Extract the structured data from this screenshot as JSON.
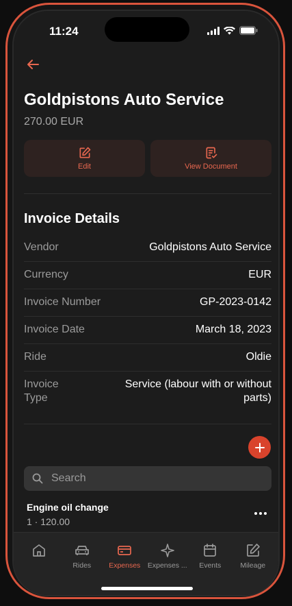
{
  "status": {
    "time": "11:24"
  },
  "header": {
    "title": "Goldpistons Auto Service",
    "amount": "270.00 EUR"
  },
  "actions": {
    "edit_label": "Edit",
    "view_document_label": "View Document"
  },
  "invoice": {
    "section_title": "Invoice Details",
    "rows": [
      {
        "label": "Vendor",
        "value": "Goldpistons Auto Service"
      },
      {
        "label": "Currency",
        "value": "EUR"
      },
      {
        "label": "Invoice Number",
        "value": "GP-2023-0142"
      },
      {
        "label": "Invoice Date",
        "value": "March 18, 2023"
      },
      {
        "label": "Ride",
        "value": "Oldie"
      },
      {
        "label": "Invoice Type",
        "value": "Service (labour with or without parts)"
      }
    ]
  },
  "search": {
    "placeholder": "Search"
  },
  "expenses": [
    {
      "name": "Engine oil change",
      "detail": "1 · 120.00"
    }
  ],
  "tabbar": {
    "tabs": [
      {
        "label": "",
        "icon": "home-icon"
      },
      {
        "label": "Rides",
        "icon": "car-icon"
      },
      {
        "label": "Expenses",
        "icon": "wallet-icon",
        "active": true
      },
      {
        "label": "Expenses ...",
        "icon": "sparkle-icon"
      },
      {
        "label": "Events",
        "icon": "calendar-icon"
      },
      {
        "label": "Mileage",
        "icon": "edit-icon"
      }
    ]
  },
  "colors": {
    "accent": "#e8674f",
    "accent_dark": "#d9432c",
    "background": "#1c1c1c"
  }
}
